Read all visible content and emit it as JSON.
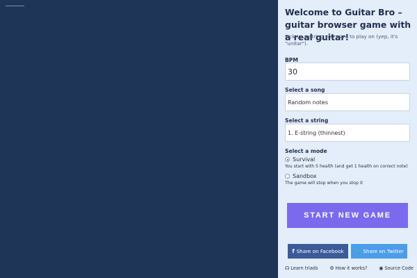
{
  "panel": {
    "title": "Welcome to Guitar Bro – guitar browser game with a real guitar!",
    "subtitle": "Pick up a string you want to play on (yep, it's \"unitar\")."
  },
  "bpm": {
    "label": "BPM",
    "value": "30"
  },
  "song": {
    "label": "Select a song",
    "value": "Random notes"
  },
  "string_select": {
    "label": "Select a string",
    "value": "1. E-string (thinnest)"
  },
  "mode": {
    "label": "Select a mode",
    "survival_label": "Survival",
    "survival_desc": "You start with 5 health (and get 1 health on correct note)",
    "sandbox_label": "Sandbox",
    "sandbox_desc": "The game will stop when you stop it"
  },
  "start_button": "START NEW GAME",
  "share": {
    "facebook": "Share on Facebook",
    "twitter": "Share on Twitter"
  },
  "footer": {
    "learn_triads": "Learn triads",
    "how_it_works": "How it works?",
    "source_code": "Source Code"
  },
  "icons": {
    "facebook": "facebook-icon",
    "twitter": "twitter-icon",
    "triads": "ear-icon",
    "how": "cogs-icon",
    "source": "github-icon"
  },
  "colors": {
    "game_bg": "#1e3558",
    "panel_bg": "#e4eefa",
    "start_button": "#7b69ee",
    "facebook": "#3b5a99",
    "twitter": "#4c9ce8"
  }
}
